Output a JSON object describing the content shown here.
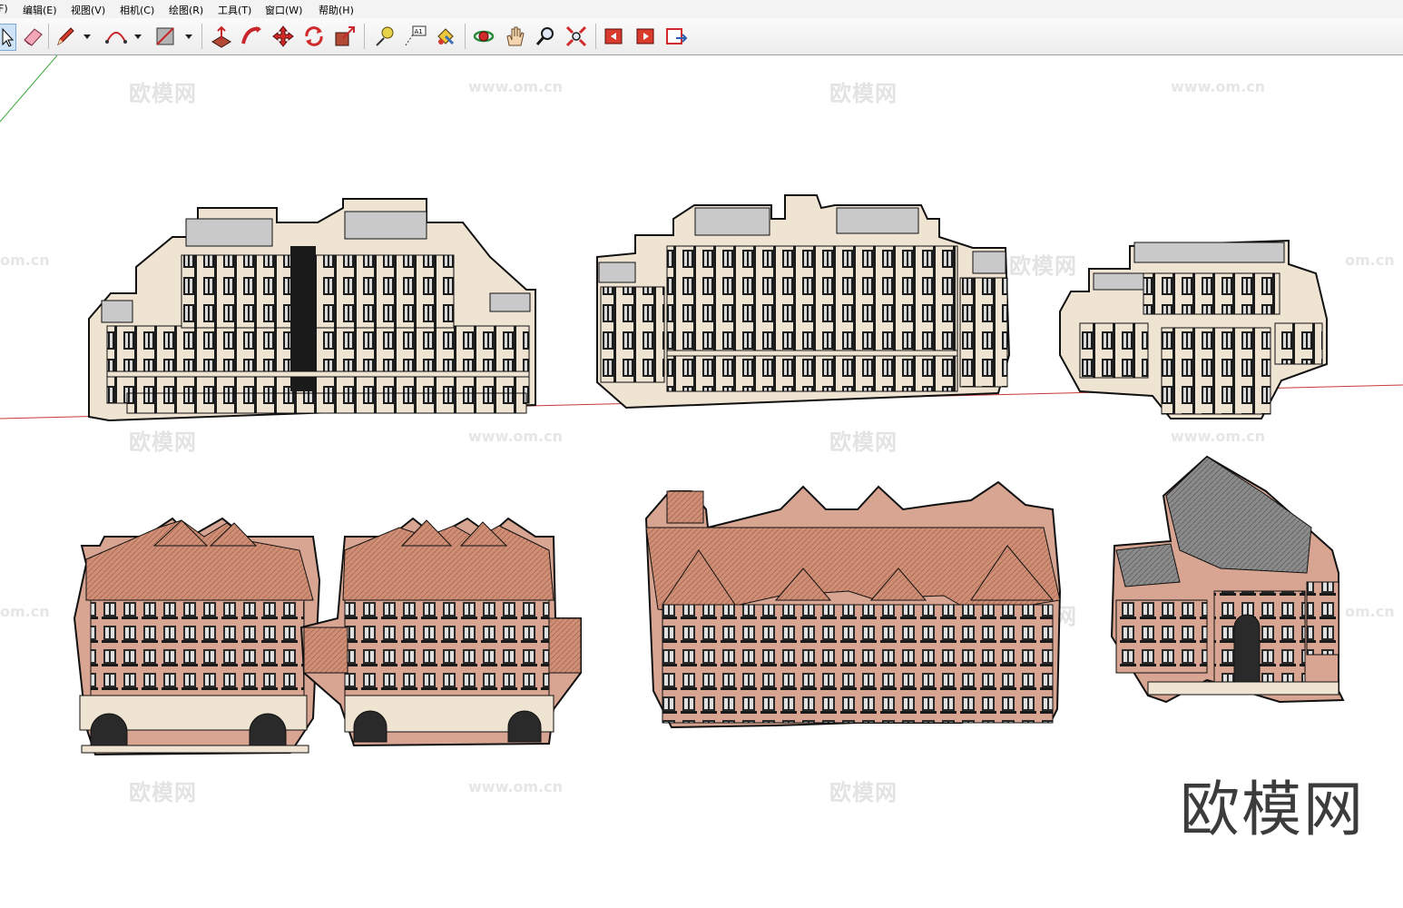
{
  "menu": [
    "F)",
    "编辑(E)",
    "视图(V)",
    "相机(C)",
    "绘图(R)",
    "工具(T)",
    "窗口(W)",
    "帮助(H)"
  ],
  "toolbar": {
    "tools": [
      "select",
      "eraser",
      "pencil",
      "arc",
      "rectangle",
      "push-pull",
      "follow-me",
      "move",
      "rotate",
      "scale",
      "tape-measure",
      "text",
      "paint-bucket",
      "orbit",
      "pan",
      "zoom",
      "zoom-extents",
      "prev-view",
      "next-view",
      "standard-views"
    ],
    "text_tool_glyph": "A1"
  },
  "watermarks": {
    "cn": "欧模网",
    "url": "www.om.cn",
    "edge": "om.cn"
  },
  "logo_text": "欧模网",
  "colors": {
    "beige_wall": "#efe3d2",
    "brick_wall": "#d8a592",
    "roof_tile": "#cf8e76",
    "flat_roof": "#c9c9c9",
    "gray_roof": "#8b8b8b",
    "red_axis": "#c83a3a",
    "green_axis": "#3aa83a"
  }
}
